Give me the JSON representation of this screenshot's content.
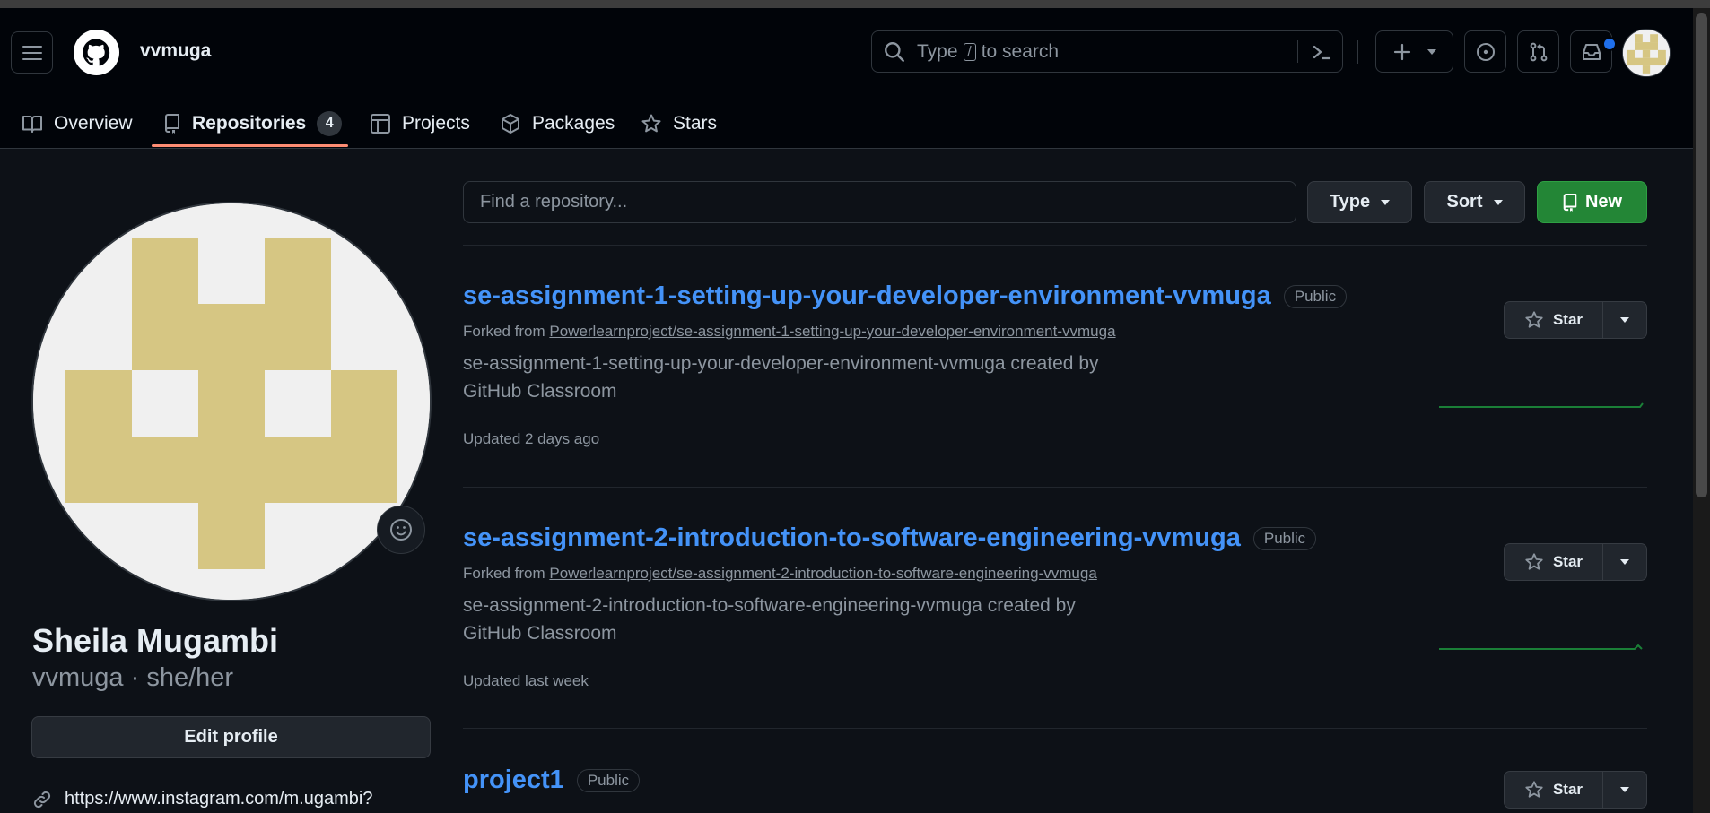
{
  "header": {
    "username": "vvmuga",
    "search_placeholder_pre": "Type",
    "search_placeholder_key": "/",
    "search_placeholder_post": "to search"
  },
  "tabs": [
    {
      "label": "Overview"
    },
    {
      "label": "Repositories",
      "count": "4"
    },
    {
      "label": "Projects"
    },
    {
      "label": "Packages"
    },
    {
      "label": "Stars"
    }
  ],
  "profile": {
    "full_name": "Sheila Mugambi",
    "handle_line": "vvmuga · she/her",
    "edit_label": "Edit profile",
    "link": "https://www.instagram.com/m.ugambi?"
  },
  "toolbar": {
    "find_placeholder": "Find a repository...",
    "type_label": "Type",
    "sort_label": "Sort",
    "new_label": "New"
  },
  "repos": [
    {
      "name": "se-assignment-1-setting-up-your-developer-environment-vvmuga",
      "visibility": "Public",
      "forked_prefix": "Forked from",
      "forked_from": "Powerlearnproject/se-assignment-1-setting-up-your-developer-environment-vvmuga",
      "description": "se-assignment-1-setting-up-your-developer-environment-vvmuga created by GitHub Classroom",
      "updated": "Updated 2 days ago",
      "star_label": "Star"
    },
    {
      "name": "se-assignment-2-introduction-to-software-engineering-vvmuga",
      "visibility": "Public",
      "forked_prefix": "Forked from",
      "forked_from": "Powerlearnproject/se-assignment-2-introduction-to-software-engineering-vvmuga",
      "description": "se-assignment-2-introduction-to-software-engineering-vvmuga created by GitHub Classroom",
      "updated": "Updated last week",
      "star_label": "Star"
    },
    {
      "name": "project1",
      "visibility": "Public",
      "star_label": "Star"
    }
  ],
  "colors": {
    "accent_link": "#4493f8",
    "new_button": "#238636",
    "tab_underline": "#fd8c73",
    "avatar_block": "#d6c683"
  }
}
